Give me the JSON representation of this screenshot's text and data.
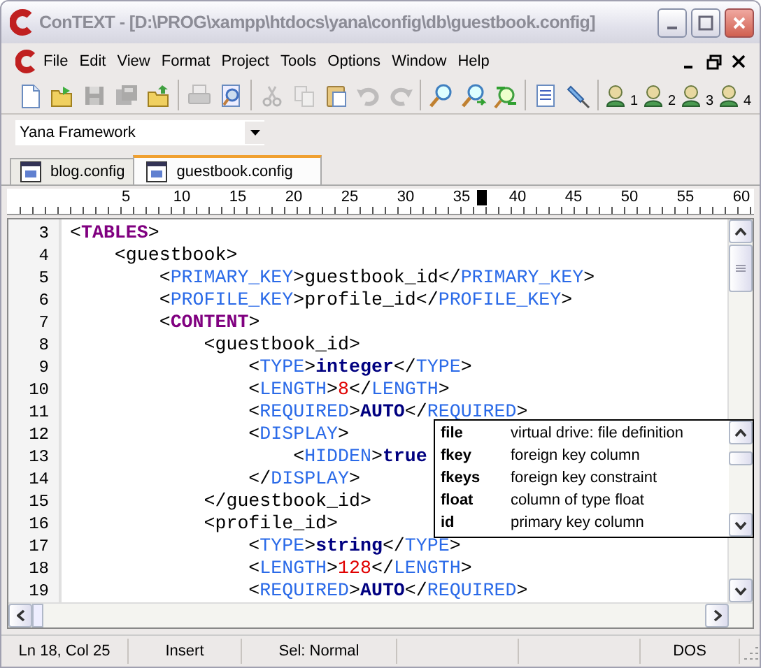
{
  "window": {
    "title": "ConTEXT - [D:\\PROG\\xampp\\htdocs\\yana\\config\\db\\guestbook.config]"
  },
  "menu": [
    "File",
    "Edit",
    "View",
    "Format",
    "Project",
    "Tools",
    "Options",
    "Window",
    "Help"
  ],
  "toolbar": [
    [
      {
        "kind": "new",
        "disabled": false
      },
      {
        "kind": "open",
        "disabled": false
      },
      {
        "kind": "save",
        "disabled": true
      },
      {
        "kind": "saveall",
        "disabled": true
      },
      {
        "kind": "folder",
        "disabled": false
      }
    ],
    [
      {
        "kind": "print",
        "disabled": true
      },
      {
        "kind": "preview",
        "disabled": false
      }
    ],
    [
      {
        "kind": "cut",
        "disabled": true
      },
      {
        "kind": "copy",
        "disabled": true
      },
      {
        "kind": "paste",
        "disabled": false
      },
      {
        "kind": "undo",
        "disabled": true
      },
      {
        "kind": "redo",
        "disabled": true
      }
    ],
    [
      {
        "kind": "find",
        "disabled": false
      },
      {
        "kind": "findnext",
        "disabled": false
      },
      {
        "kind": "replace",
        "disabled": false
      }
    ],
    [
      {
        "kind": "doclist",
        "disabled": false
      },
      {
        "kind": "pin",
        "disabled": false
      }
    ],
    [
      {
        "kind": "user",
        "label": "1",
        "disabled": false
      },
      {
        "kind": "user",
        "label": "2",
        "disabled": false
      },
      {
        "kind": "user",
        "label": "3",
        "disabled": false
      },
      {
        "kind": "user",
        "label": "4",
        "disabled": false
      }
    ]
  ],
  "project_combo": {
    "value": "Yana Framework"
  },
  "tabs": [
    {
      "label": "blog.config",
      "selected": false
    },
    {
      "label": "guestbook.config",
      "selected": true
    }
  ],
  "ruler": [
    {
      "label": "5",
      "marked": false
    },
    {
      "label": "10",
      "marked": false
    },
    {
      "label": "15",
      "marked": false
    },
    {
      "label": "20",
      "marked": false
    },
    {
      "label": "25",
      "marked": false
    },
    {
      "label": "30",
      "marked": false
    },
    {
      "label": "35",
      "marked": true
    },
    {
      "label": "40",
      "marked": false
    },
    {
      "label": "45",
      "marked": false
    },
    {
      "label": "50",
      "marked": false
    },
    {
      "label": "55",
      "marked": false
    },
    {
      "label": "60",
      "marked": false
    }
  ],
  "lines": [
    {
      "number": "3",
      "tokens": [
        {
          "kind": "punct",
          "text": "<"
        },
        {
          "kind": "section",
          "text": "TABLES"
        },
        {
          "kind": "punct",
          "text": ">"
        }
      ]
    },
    {
      "number": "4",
      "tokens": [
        {
          "kind": "punct",
          "text": "    <guestbook>"
        }
      ]
    },
    {
      "number": "5",
      "tokens": [
        {
          "kind": "punct",
          "text": "        <"
        },
        {
          "kind": "tag",
          "text": "PRIMARY_KEY"
        },
        {
          "kind": "punct",
          "text": ">guestbook_id</"
        },
        {
          "kind": "tag",
          "text": "PRIMARY_KEY"
        },
        {
          "kind": "punct",
          "text": ">"
        }
      ]
    },
    {
      "number": "6",
      "tokens": [
        {
          "kind": "punct",
          "text": "        <"
        },
        {
          "kind": "tag",
          "text": "PROFILE_KEY"
        },
        {
          "kind": "punct",
          "text": ">profile_id</"
        },
        {
          "kind": "tag",
          "text": "PROFILE_KEY"
        },
        {
          "kind": "punct",
          "text": ">"
        }
      ]
    },
    {
      "number": "7",
      "tokens": [
        {
          "kind": "punct",
          "text": "        <"
        },
        {
          "kind": "section",
          "text": "CONTENT"
        },
        {
          "kind": "punct",
          "text": ">"
        }
      ]
    },
    {
      "number": "8",
      "tokens": [
        {
          "kind": "punct",
          "text": "            <guestbook_id>"
        }
      ]
    },
    {
      "number": "9",
      "tokens": [
        {
          "kind": "punct",
          "text": "                <"
        },
        {
          "kind": "tag",
          "text": "TYPE"
        },
        {
          "kind": "punct",
          "text": ">"
        },
        {
          "kind": "keyword",
          "text": "integer"
        },
        {
          "kind": "punct",
          "text": "</"
        },
        {
          "kind": "tag",
          "text": "TYPE"
        },
        {
          "kind": "punct",
          "text": ">"
        }
      ]
    },
    {
      "number": "10",
      "tokens": [
        {
          "kind": "punct",
          "text": "                <"
        },
        {
          "kind": "tag",
          "text": "LENGTH"
        },
        {
          "kind": "punct",
          "text": ">"
        },
        {
          "kind": "number",
          "text": "8"
        },
        {
          "kind": "punct",
          "text": "</"
        },
        {
          "kind": "tag",
          "text": "LENGTH"
        },
        {
          "kind": "punct",
          "text": ">"
        }
      ]
    },
    {
      "number": "11",
      "tokens": [
        {
          "kind": "punct",
          "text": "                <"
        },
        {
          "kind": "tag",
          "text": "REQUIRED"
        },
        {
          "kind": "punct",
          "text": ">"
        },
        {
          "kind": "keyword",
          "text": "AUTO"
        },
        {
          "kind": "punct",
          "text": "</"
        },
        {
          "kind": "tag",
          "text": "REQUIRED"
        },
        {
          "kind": "punct",
          "text": ">"
        }
      ]
    },
    {
      "number": "12",
      "tokens": [
        {
          "kind": "punct",
          "text": "                <"
        },
        {
          "kind": "tag",
          "text": "DISPLAY"
        },
        {
          "kind": "punct",
          "text": ">"
        }
      ]
    },
    {
      "number": "13",
      "tokens": [
        {
          "kind": "punct",
          "text": "                    <"
        },
        {
          "kind": "tag",
          "text": "HIDDEN"
        },
        {
          "kind": "punct",
          "text": ">"
        },
        {
          "kind": "keyword",
          "text": "true"
        }
      ]
    },
    {
      "number": "14",
      "tokens": [
        {
          "kind": "punct",
          "text": "                </"
        },
        {
          "kind": "tag",
          "text": "DISPLAY"
        },
        {
          "kind": "punct",
          "text": ">"
        }
      ]
    },
    {
      "number": "15",
      "tokens": [
        {
          "kind": "punct",
          "text": "            </guestbook_id>"
        }
      ]
    },
    {
      "number": "16",
      "tokens": [
        {
          "kind": "punct",
          "text": "            <profile_id>"
        }
      ]
    },
    {
      "number": "17",
      "tokens": [
        {
          "kind": "punct",
          "text": "                <"
        },
        {
          "kind": "tag",
          "text": "TYPE"
        },
        {
          "kind": "punct",
          "text": ">"
        },
        {
          "kind": "keyword",
          "text": "string"
        },
        {
          "kind": "punct",
          "text": "</"
        },
        {
          "kind": "tag",
          "text": "TYPE"
        },
        {
          "kind": "punct",
          "text": ">"
        }
      ]
    },
    {
      "number": "18",
      "tokens": [
        {
          "kind": "punct",
          "text": "                <"
        },
        {
          "kind": "tag",
          "text": "LENGTH"
        },
        {
          "kind": "punct",
          "text": ">"
        },
        {
          "kind": "number",
          "text": "128"
        },
        {
          "kind": "punct",
          "text": "</"
        },
        {
          "kind": "tag",
          "text": "LENGTH"
        },
        {
          "kind": "punct",
          "text": ">"
        }
      ]
    },
    {
      "number": "19",
      "tokens": [
        {
          "kind": "punct",
          "text": "                <"
        },
        {
          "kind": "tag",
          "text": "REQUIRED"
        },
        {
          "kind": "punct",
          "text": ">"
        },
        {
          "kind": "keyword",
          "text": "AUTO"
        },
        {
          "kind": "punct",
          "text": "</"
        },
        {
          "kind": "tag",
          "text": "REQUIRED"
        },
        {
          "kind": "punct",
          "text": ">"
        }
      ]
    }
  ],
  "completion": [
    {
      "word": "file",
      "description": "virtual drive: file definition"
    },
    {
      "word": "fkey",
      "description": "foreign key column"
    },
    {
      "word": "fkeys",
      "description": "foreign key constraint"
    },
    {
      "word": "float",
      "description": "column of type float"
    },
    {
      "word": "id",
      "description": "primary key column"
    }
  ],
  "status_bar": [
    "Ln 18, Col 25",
    "Insert",
    "Sel: Normal",
    "DOS"
  ]
}
